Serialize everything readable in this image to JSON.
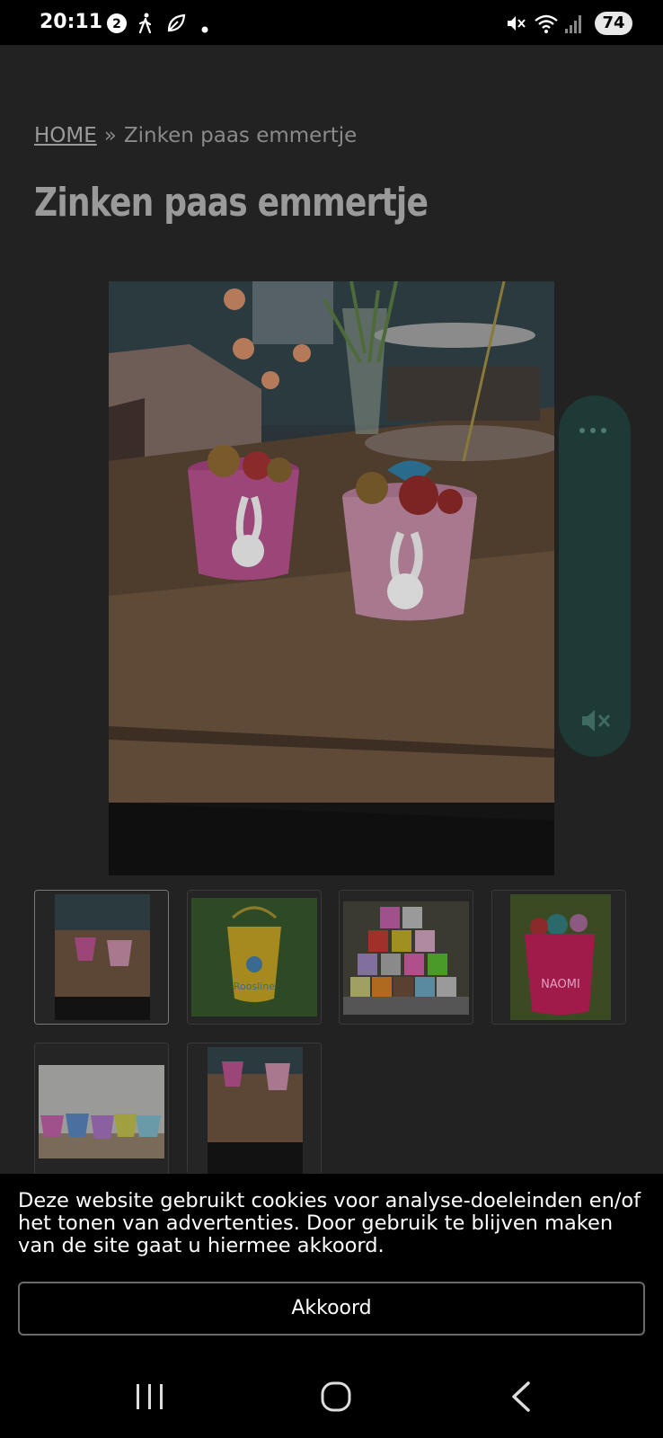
{
  "status_bar": {
    "time": "20:11",
    "battery": "74",
    "notification_badge": "2",
    "icons": [
      "notification-badge-icon",
      "walking-icon",
      "leaf-icon",
      "dot-icon",
      "mute-icon",
      "wifi-icon",
      "signal-icon"
    ]
  },
  "breadcrumb": {
    "home": "HOME",
    "separator": "»",
    "current": "Zinken paas emmertje"
  },
  "page": {
    "title": "Zinken paas emmertje"
  },
  "gallery": {
    "thumbnails": [
      {
        "name": "thumb-1",
        "subject": "two bunny buckets on table",
        "active": true
      },
      {
        "name": "thumb-2",
        "subject": "yellow bucket Roosline"
      },
      {
        "name": "thumb-3",
        "subject": "stacked colored buckets"
      },
      {
        "name": "thumb-4",
        "subject": "pink bucket NAOMI"
      },
      {
        "name": "thumb-5",
        "subject": "row of bunny buckets"
      },
      {
        "name": "thumb-6",
        "subject": "two bunny buckets on table"
      }
    ],
    "thumb_texts": {
      "roosline": "Roosline",
      "naomi": "NAOMI"
    }
  },
  "side_panel": {
    "icons": [
      "more-icon",
      "volume-mute-icon"
    ]
  },
  "cookie": {
    "text": "Deze website gebruikt cookies voor analyse-doeleinden en/of het tonen van advertenties. Door gebruik te blijven maken van de site gaat u hiermee akkoord.",
    "button": "Akkoord"
  },
  "nav_bar": {
    "icons": [
      "recent-apps-icon",
      "home-icon",
      "back-icon"
    ]
  },
  "colors": {
    "background": "#222222",
    "cookie_bg": "#000000",
    "side_panel": "#1d3a36",
    "text_muted": "#9a9a9a"
  }
}
